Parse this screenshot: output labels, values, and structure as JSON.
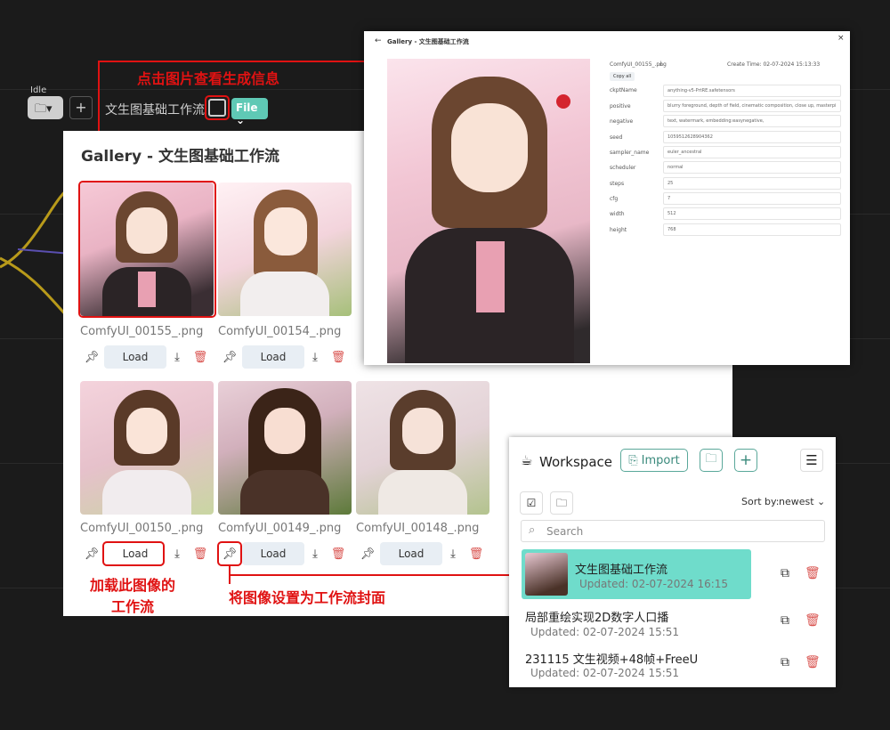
{
  "annotations": {
    "click_image": "点击图片查看生成信息",
    "load_workflow_l1": "加载此图像的",
    "load_workflow_l2": "工作流",
    "set_cover": "将图像设置为工作流封面"
  },
  "toolbar": {
    "status": "Idle",
    "workflow_name": "文生图基础工作流",
    "file_label": "File"
  },
  "gallery": {
    "title": "Gallery - 文生图基础工作流",
    "load_label": "Load",
    "images": [
      {
        "name": "ComfyUI_00155_.png"
      },
      {
        "name": "ComfyUI_00154_.png"
      },
      {
        "name": "ComfyUI_00150_.png"
      },
      {
        "name": "ComfyUI_00149_.png"
      },
      {
        "name": "ComfyUI_00148_.png"
      }
    ]
  },
  "detail": {
    "title": "Gallery - 文生图基础工作流",
    "close": "×",
    "back": "←",
    "filename": "ComfyUI_00155_.png",
    "create_time": "Create Time: 02-07-2024 15:13:33",
    "copy_all": "Copy all",
    "fields": [
      {
        "key": "ckptName",
        "value": "anything-v5-PrtRE.safetensors"
      },
      {
        "key": "positive",
        "value": "blurry foreground, depth of field, cinematic composition, close up, masterpi"
      },
      {
        "key": "negative",
        "value": "text, watermark, embedding:easynegative,"
      },
      {
        "key": "seed",
        "value": "1059512628904362"
      },
      {
        "key": "sampler_name",
        "value": "euler_ancestral"
      },
      {
        "key": "scheduler",
        "value": "normal"
      },
      {
        "key": "steps",
        "value": "25"
      },
      {
        "key": "cfg",
        "value": "7"
      },
      {
        "key": "width",
        "value": "512"
      },
      {
        "key": "height",
        "value": "768"
      }
    ]
  },
  "workspace": {
    "title": "Workspace",
    "import_label": "Import",
    "sort_label": "Sort by:",
    "sort_value": "newest",
    "search_placeholder": "Search",
    "items": [
      {
        "title": "文生图基础工作流",
        "updated": "Updated: 02-07-2024 16:15"
      },
      {
        "title": "局部重绘实现2D数字人口播",
        "updated": "Updated: 02-07-2024 15:51"
      },
      {
        "title": "231115 文生视频+48帧+FreeU",
        "updated": "Updated: 02-07-2024 15:51"
      }
    ]
  },
  "colors": {
    "annotation_red": "#e01212",
    "accent_teal": "#6fdccb",
    "delete_red": "#d9534f"
  }
}
